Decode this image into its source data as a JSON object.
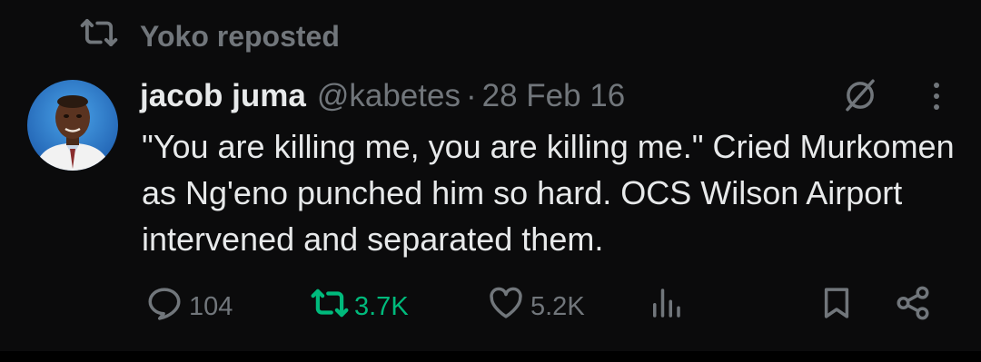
{
  "repost_context": {
    "label": "Yoko reposted"
  },
  "post": {
    "display_name": "jacob juma",
    "handle": "@kabetes",
    "separator": "·",
    "date": "28 Feb 16",
    "text": "\"You are killing me, you are killing me.\" Cried Murkomen as Ng'eno punched him so hard. OCS Wilson Airport intervened and separated them."
  },
  "actions": {
    "reply_count": "104",
    "repost_count": "3.7K",
    "like_count": "5.2K"
  },
  "colors": {
    "background": "#0b0b0c",
    "primary_text": "#e7e9ea",
    "secondary_text": "#71767b",
    "repost_active": "#00ba7c"
  },
  "icons": [
    "repost-icon",
    "avatar",
    "grok-icon",
    "more-icon",
    "reply-icon",
    "repost-icon",
    "like-icon",
    "views-icon",
    "bookmark-icon",
    "share-icon"
  ]
}
